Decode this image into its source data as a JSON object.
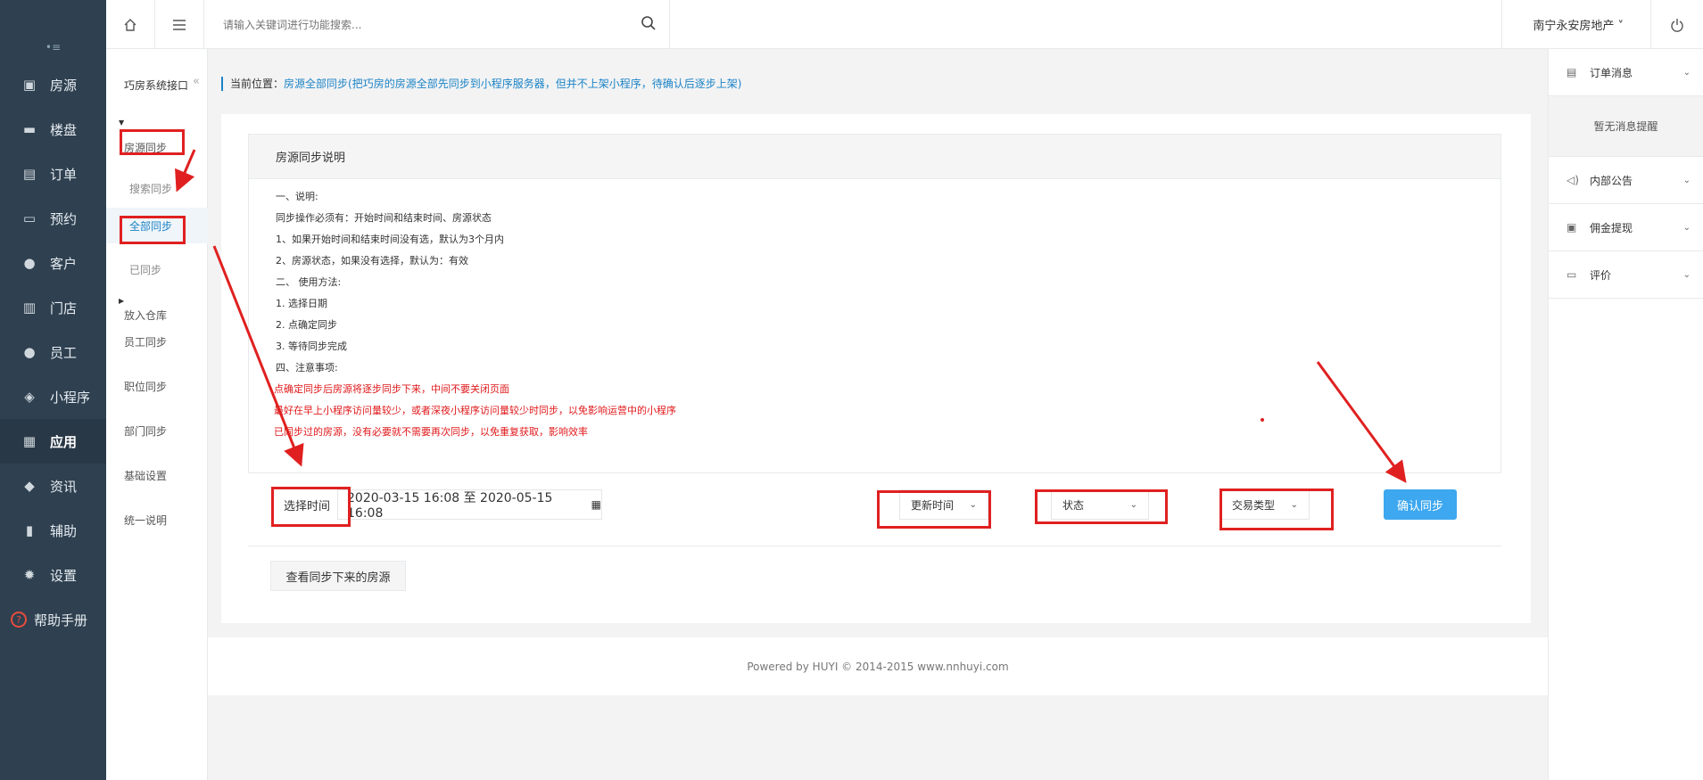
{
  "nav": {
    "toggle": "•≡",
    "items": [
      {
        "label": "房源",
        "icon": "building-icon"
      },
      {
        "label": "楼盘",
        "icon": "box-icon"
      },
      {
        "label": "订单",
        "icon": "document-icon"
      },
      {
        "label": "预约",
        "icon": "inbox-icon"
      },
      {
        "label": "客户",
        "icon": "user-icon"
      },
      {
        "label": "门店",
        "icon": "store-icon"
      },
      {
        "label": "员工",
        "icon": "user-icon"
      },
      {
        "label": "小程序",
        "icon": "wechat-icon"
      },
      {
        "label": "应用",
        "icon": "apps-icon"
      },
      {
        "label": "资讯",
        "icon": "tag-icon"
      },
      {
        "label": "辅助",
        "icon": "book-icon"
      },
      {
        "label": "设置",
        "icon": "gear-icon"
      },
      {
        "label": "帮助手册",
        "icon": "help-icon"
      }
    ],
    "active_index": 8
  },
  "topbar": {
    "search_placeholder": "请输入关键词进行功能搜索...",
    "company": "南宁永安房地产 ˅"
  },
  "subnav": {
    "title": "巧房系统接口",
    "items": [
      {
        "label": "房源同步",
        "type": "parent"
      },
      {
        "label": "搜索同步",
        "type": "child"
      },
      {
        "label": "全部同步",
        "type": "child"
      },
      {
        "label": "已同步",
        "type": "child"
      },
      {
        "label": "放入仓库",
        "type": "parent"
      },
      {
        "label": "员工同步",
        "type": "parent"
      },
      {
        "label": "职位同步",
        "type": "parent"
      },
      {
        "label": "部门同步",
        "type": "parent"
      },
      {
        "label": "基础设置",
        "type": "parent"
      },
      {
        "label": "统一说明",
        "type": "parent"
      }
    ]
  },
  "rpanel": {
    "order_msg": "订单消息",
    "no_msg": "暂无消息提醒",
    "notice": "内部公告",
    "commission": "佣金提现",
    "review": "评价"
  },
  "breadcrumb": {
    "prefix": "当前位置：",
    "link": "房源全部同步(把巧房的房源全部先同步到小程序服务器，但并不上架小程序，待确认后逐步上架)"
  },
  "info": {
    "title": "房源同步说明",
    "lines": [
      {
        "text": "一、说明:",
        "red": false
      },
      {
        "text": "同步操作必须有：开始时间和结束时间、房源状态",
        "red": false
      },
      {
        "text": "1、如果开始时间和结束时间没有选，默认为3个月内",
        "red": false
      },
      {
        "text": "2、房源状态，如果没有选择，默认为：有效",
        "red": false
      },
      {
        "text": "二、 使用方法:",
        "red": false
      },
      {
        "text": "1. 选择日期",
        "red": false
      },
      {
        "text": "2. 点确定同步",
        "red": false
      },
      {
        "text": "3. 等待同步完成",
        "red": false
      },
      {
        "text": "四、注意事项:",
        "red": false
      },
      {
        "text": "点确定同步后房源将逐步同步下来，中间不要关闭页面",
        "red": true
      },
      {
        "text": "最好在早上小程序访问量较少，或者深夜小程序访问量较少时同步，以免影响运营中的小程序",
        "red": true
      },
      {
        "text": "已同步过的房源，没有必要就不需要再次同步，以免重复获取，影响效率",
        "red": true
      }
    ]
  },
  "form": {
    "time_label": "选择时间",
    "date_range": "2020-03-15 16:08 至 2020-05-15 16:08",
    "sort_select": "更新时间",
    "status_select": "状态",
    "trade_select": "交易类型",
    "confirm_btn": "确认同步",
    "view_btn": "查看同步下来的房源"
  },
  "footer": "Powered by HUYI © 2014-2015 www.nnhuyi.com",
  "colors": {
    "nav_bg": "#2f4050",
    "accent": "#1c84c6",
    "primary_btn": "#3da7ef",
    "annotation": "#e02020"
  }
}
